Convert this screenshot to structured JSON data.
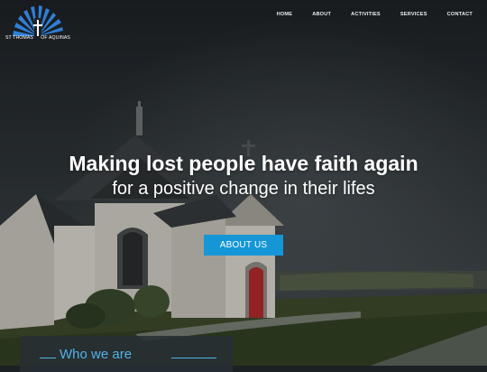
{
  "brand": {
    "left_text": "ST THOMAS",
    "right_text": "OF AQUINAS",
    "accent": "#2f7fd6"
  },
  "nav": {
    "items": [
      {
        "label": "HOME"
      },
      {
        "label": "ABOUT"
      },
      {
        "label": "ACTIVITIES"
      },
      {
        "label": "SERVICES"
      },
      {
        "label": "CONTACT"
      }
    ]
  },
  "hero": {
    "headline": "Making lost people have faith again",
    "subheadline": "for a positive change in their lifes",
    "cta_label": "ABOUT US",
    "cta_color": "#1596d7"
  },
  "section": {
    "title": "Who we are"
  }
}
